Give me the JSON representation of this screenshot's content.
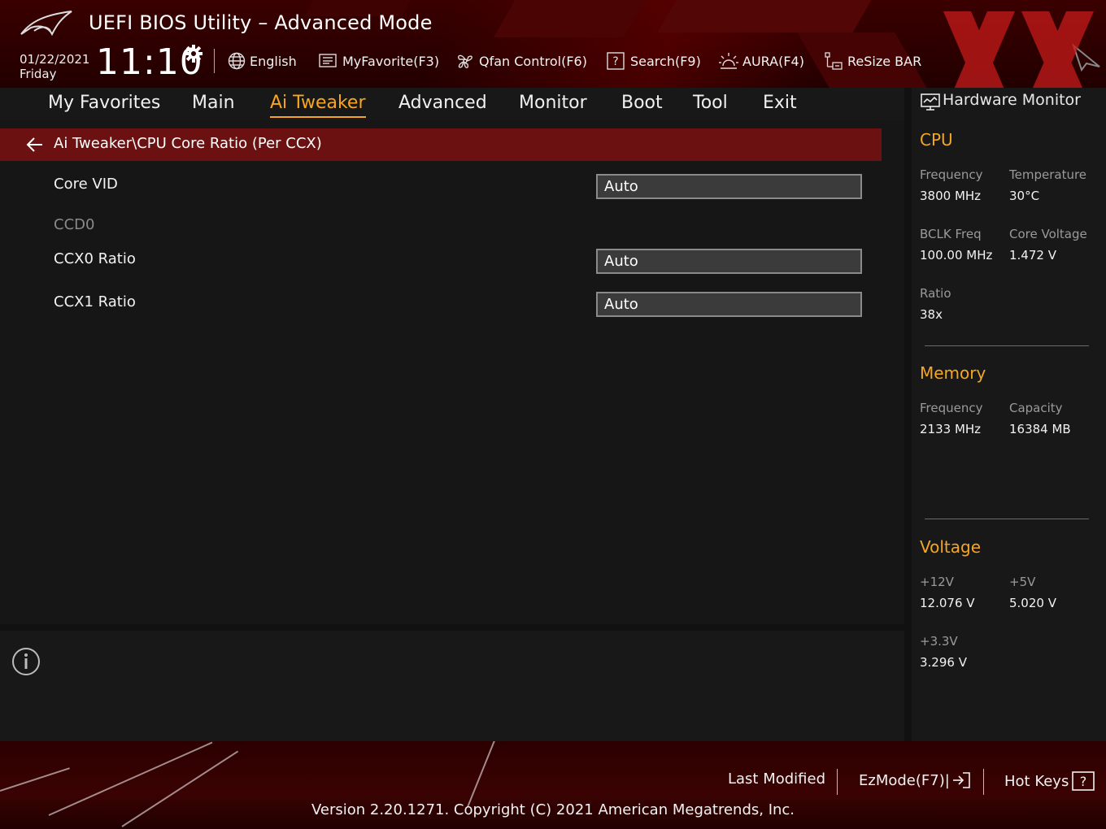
{
  "header": {
    "title": "UEFI BIOS Utility – Advanced Mode",
    "date": "01/22/2021",
    "day": "Friday",
    "time": "11:10",
    "tools": [
      {
        "label": "English",
        "icon": "globe-icon"
      },
      {
        "label": "MyFavorite(F3)",
        "icon": "favorite-icon"
      },
      {
        "label": "Qfan Control(F6)",
        "icon": "fan-icon"
      },
      {
        "label": "Search(F9)",
        "icon": "search-help-icon"
      },
      {
        "label": "AURA(F4)",
        "icon": "aura-light-icon"
      },
      {
        "label": "ReSize BAR",
        "icon": "resize-bar-icon"
      }
    ]
  },
  "nav": {
    "tabs": [
      "My Favorites",
      "Main",
      "Ai Tweaker",
      "Advanced",
      "Monitor",
      "Boot",
      "Tool",
      "Exit"
    ],
    "active": "Ai Tweaker"
  },
  "main": {
    "breadcrumb": "Ai Tweaker\\CPU Core Ratio (Per CCX)",
    "rows": [
      {
        "label": "Core VID",
        "value": "Auto"
      },
      {
        "label": "CCD0"
      },
      {
        "label": "CCX0 Ratio",
        "value": "Auto"
      },
      {
        "label": "CCX1 Ratio",
        "value": "Auto"
      }
    ]
  },
  "hardware_monitor": {
    "title": "Hardware Monitor",
    "cpu": {
      "heading": "CPU",
      "frequency_label": "Frequency",
      "frequency": "3800 MHz",
      "temperature_label": "Temperature",
      "temperature": "30°C",
      "bclk_label": "BCLK Freq",
      "bclk": "100.00 MHz",
      "core_voltage_label": "Core Voltage",
      "core_voltage": "1.472 V",
      "ratio_label": "Ratio",
      "ratio": "38x"
    },
    "memory": {
      "heading": "Memory",
      "frequency_label": "Frequency",
      "frequency": "2133 MHz",
      "capacity_label": "Capacity",
      "capacity": "16384 MB"
    },
    "voltage": {
      "heading": "Voltage",
      "v12_label": "+12V",
      "v12": "12.076 V",
      "v5_label": "+5V",
      "v5": "5.020 V",
      "v33_label": "+3.3V",
      "v33": "3.296 V"
    }
  },
  "footer": {
    "last_modified": "Last Modified",
    "ezmode": "EzMode(F7)|",
    "hotkeys": "Hot Keys",
    "version": "Version 2.20.1271. Copyright (C) 2021 American Megatrends, Inc."
  },
  "colors": {
    "accent": "#f5a623",
    "breadcrumb_bg": "#6b1111",
    "header_red": "#3a0000"
  }
}
